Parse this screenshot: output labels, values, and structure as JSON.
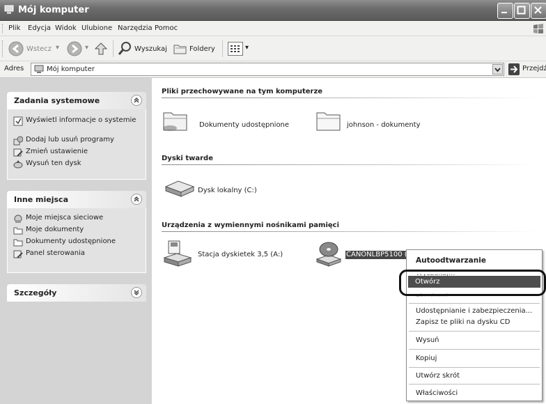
{
  "window": {
    "title": "Mój komputer"
  },
  "menu": [
    "Plik",
    "Edycja",
    "Widok",
    "Ulubione",
    "Narzędzia",
    "Pomoc"
  ],
  "toolbar": {
    "back": "Wstecz",
    "search": "Wyszukaj",
    "folders": "Foldery"
  },
  "address": {
    "label": "Adres",
    "value": "Mój komputer",
    "go": "Przejdź"
  },
  "left_panel": {
    "system_tasks": {
      "title": "Zadania systemowe",
      "items": [
        "Wyświetl informacje o systemie",
        "Dodaj lub usuń programy",
        "Zmień ustawienie",
        "Wysuń ten dysk"
      ]
    },
    "other_places": {
      "title": "Inne miejsca",
      "items": [
        "Moje miejsca sieciowe",
        "Moje dokumenty",
        "Dokumenty udostępnione",
        "Panel sterowania"
      ]
    },
    "details": {
      "title": "Szczegóły"
    }
  },
  "main": {
    "groups": [
      {
        "title": "Pliki przechowywane na tym komputerze",
        "items": [
          "Dokumenty udostępnione",
          "johnson - dokumenty"
        ]
      },
      {
        "title": "Dyski twarde",
        "items": [
          "Dysk lokalny (C:)"
        ]
      },
      {
        "title": "Urządzenia z wymiennymi nośnikami pamięci",
        "items": [
          "Stacja dyskietek 3,5 (A:)",
          "CANONLBP5100 (D"
        ]
      }
    ]
  },
  "context_menu": {
    "items": [
      "Autoodtwarzanie",
      "Otwórz",
      "Udostępnianie i zabezpieczenia...",
      "Zapisz te pliki na dysku CD",
      "Wysuń",
      "Kopiuj",
      "Utwórz skrót",
      "Właściwości"
    ],
    "selected": "Otwórz"
  }
}
